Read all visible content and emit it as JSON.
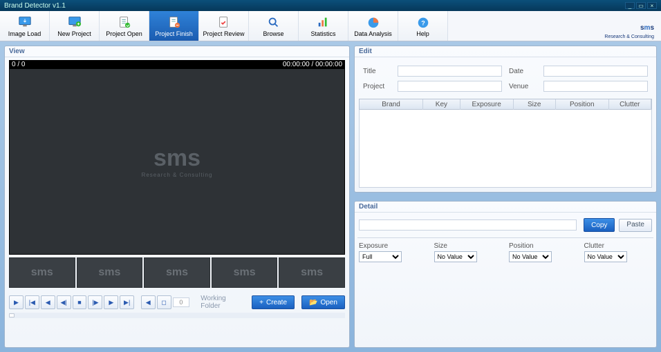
{
  "title": "Brand Detector v1.1",
  "toolbar": [
    {
      "id": "image-load",
      "label": "Image Load",
      "icon": "monitor-down"
    },
    {
      "id": "new-project",
      "label": "New Project",
      "icon": "monitor-plus"
    },
    {
      "id": "project-open",
      "label": "Project Open",
      "icon": "doc-open"
    },
    {
      "id": "project-finish",
      "label": "Project Finish",
      "icon": "doc-check",
      "active": true
    },
    {
      "id": "project-review",
      "label": "Project Review",
      "icon": "doc-tick"
    },
    {
      "id": "browse",
      "label": "Browse",
      "icon": "magnifier"
    },
    {
      "id": "statistics",
      "label": "Statistics",
      "icon": "chart"
    },
    {
      "id": "data-analysis",
      "label": "Data Analysis",
      "icon": "analysis"
    },
    {
      "id": "help",
      "label": "Help",
      "icon": "help"
    }
  ],
  "logo": {
    "text": "sms",
    "sub": "Research & Consulting"
  },
  "view": {
    "header": "View",
    "frame": "0 / 0",
    "time": "00:00:00 / 00:00:00",
    "workingFolder": "Working Folder",
    "create": "Create",
    "open": "Open",
    "count": "0"
  },
  "edit": {
    "header": "Edit",
    "title_lbl": "Title",
    "project_lbl": "Project",
    "date_lbl": "Date",
    "venue_lbl": "Venue",
    "title": "",
    "project": "",
    "date": "",
    "venue": "",
    "cols": [
      "Brand",
      "Key",
      "Exposure",
      "Size",
      "Position",
      "Clutter"
    ]
  },
  "detail": {
    "header": "Detail",
    "copy": "Copy",
    "paste": "Paste",
    "input": "",
    "fields": [
      {
        "label": "Exposure",
        "value": "Full"
      },
      {
        "label": "Size",
        "value": "No Value"
      },
      {
        "label": "Position",
        "value": "No Value"
      },
      {
        "label": "Clutter",
        "value": "No Value"
      }
    ]
  }
}
